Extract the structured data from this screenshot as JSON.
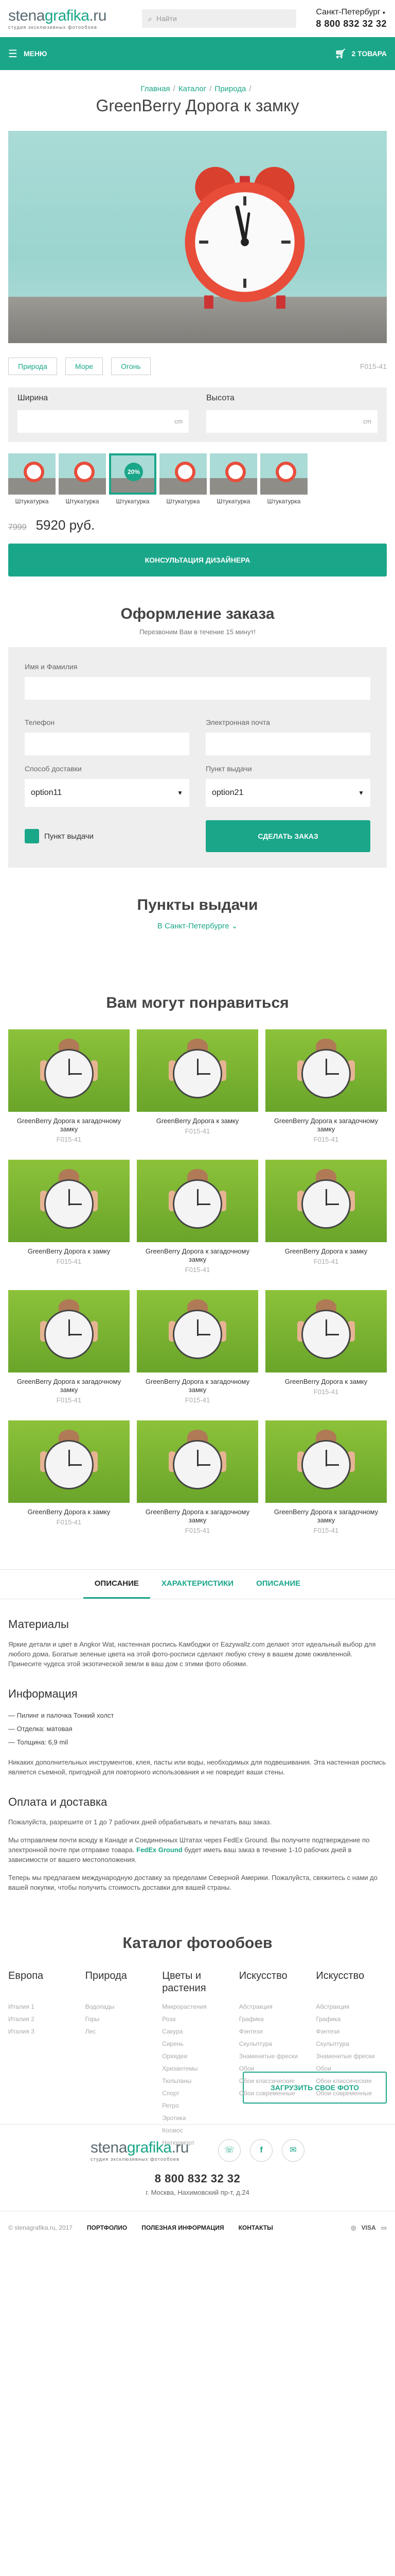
{
  "header": {
    "logo_main_a": "stena",
    "logo_main_b": "grafika",
    "logo_main_c": ".ru",
    "logo_sub": "студия эксклюзивных фотообоев",
    "search_placeholder": "Найти",
    "city": "Санкт-Петербург",
    "phone": "8 800 832 32 32"
  },
  "nav": {
    "menu": "МЕНЮ",
    "cart": "2 ТОВАРА"
  },
  "breadcrumbs": [
    "Главная",
    "Каталог",
    "Природа"
  ],
  "product": {
    "title": "GreenBerry Дорога к замку",
    "tags": [
      "Природа",
      "Море",
      "Огонь"
    ],
    "sku": "F015-41",
    "width_label": "Ширина",
    "height_label": "Высота",
    "unit": "cm",
    "textures": [
      {
        "label": "Штукатурка"
      },
      {
        "label": "Штукатурка"
      },
      {
        "label": "Штукатурка",
        "badge": "20%"
      },
      {
        "label": "Штукатурка"
      },
      {
        "label": "Штукатурка"
      },
      {
        "label": "Штукатурка"
      }
    ],
    "old_price": "7999",
    "price": "5920 руб.",
    "consult_button": "КОНСУЛЬТАЦИЯ ДИЗАЙНЕРА"
  },
  "order": {
    "title": "Оформление заказа",
    "subtitle": "Перезвоним Вам в течение 15 минут!",
    "name_label": "Имя и Фамилия",
    "phone_label": "Телефон",
    "email_label": "Электронная почта",
    "delivery_label": "Способ доставки",
    "delivery_value": "option11",
    "pickup_label": "Пункт выдачи",
    "pickup_value": "option21",
    "checkbox_label": "Пункт выдачи",
    "submit": "СДЕЛАТЬ ЗАКАЗ"
  },
  "pickup": {
    "title": "Пункты выдачи",
    "city": "В Санкт-Петербурге"
  },
  "recommend": {
    "title": "Вам могут понравиться",
    "items": [
      {
        "title": "GreenBerry Дорога к загадочному замку",
        "sku": "F015-41"
      },
      {
        "title": "GreenBerry Дорога к замку",
        "sku": "F015-41"
      },
      {
        "title": "GreenBerry Дорога к загадочному замку",
        "sku": "F015-41"
      },
      {
        "title": "GreenBerry Дорога к замку",
        "sku": "F015-41"
      },
      {
        "title": "GreenBerry Дорога к загадочному замку",
        "sku": "F015-41"
      },
      {
        "title": "GreenBerry Дорога к замку",
        "sku": "F015-41"
      },
      {
        "title": "GreenBerry Дорога к загадочному замку",
        "sku": "F015-41"
      },
      {
        "title": "GreenBerry Дорога к загадочному замку",
        "sku": "F015-41"
      },
      {
        "title": "GreenBerry Дорога к замку",
        "sku": "F015-41"
      },
      {
        "title": "GreenBerry Дорога к замку",
        "sku": "F015-41"
      },
      {
        "title": "GreenBerry Дорога к загадочному замку",
        "sku": "F015-41"
      },
      {
        "title": "GreenBerry Дорога к загадочному замку",
        "sku": "F015-41"
      }
    ]
  },
  "tabs": [
    "ОПИСАНИЕ",
    "ХАРАКТЕРИСТИКИ",
    "ОПИСАНИЕ"
  ],
  "desc": {
    "materials_h": "Материалы",
    "materials_p": "Яркие детали и цвет в Angkor Wat, настенная роспись Камбоджи от Eazywallz.com делают этот идеальный выбор для любого дома. Богатые зеленые цвета на этой фото-росписи сделают любую стену в вашем доме оживленной. Принесите чудеса этой экзотической земли в ваш дом с этими фото обоями.",
    "info_h": "Информация",
    "info_items": [
      "Пилинг и палочка Тонкий холст",
      "Отделка: матовая",
      "Толщина: 6,9 mil"
    ],
    "info_p": "Никаких дополнительных инструментов, клея, пасты или воды, необходимых для подвешивания. Эта настенная роспись является съемной, пригодной для повторного использования и не повредит ваши стены.",
    "pay_h": "Оплата и доставка",
    "pay_p1": "Пожалуйста, разрешите от 1 до 7 рабочих дней обрабатывать и печатать ваш заказ.",
    "pay_p2a": "Мы отправляем почти всюду в Канаде и Соединенных Штатах через FedEx Ground. Вы получите подтверждение по электронной почте при отправке товара.",
    "pay_p2b": "FedEx Ground",
    "pay_p2c": " будет иметь ваш заказ в течение 1-10 рабочих дней в зависимости от вашего местоположения.",
    "pay_p3": "Теперь мы предлагаем международную доставку за пределами Северной Америки. Пожалуйста, свяжитесь с нами до вашей покупки, чтобы получить стоимость доставки для вашей страны."
  },
  "catalog": {
    "title": "Каталог фотообоев",
    "columns": [
      {
        "h": "Европа",
        "items": [
          "Италия 1",
          "Италия 2",
          "Италия 3"
        ]
      },
      {
        "h": "Природа",
        "items": [
          "Водопады",
          "Горы",
          "Лес"
        ]
      },
      {
        "h": "Цветы и растения",
        "items": [
          "Микрорастения",
          "Роза",
          "Сакура",
          "Сирень",
          "Орхидеи",
          "Хризантемы",
          "Тюльпаны",
          "Спорт",
          "Ретро",
          "Эротика",
          "Космос",
          "Натюрморт"
        ]
      },
      {
        "h": "Искусство",
        "items": [
          "Абстракция",
          "Графика",
          "Фэнтези",
          "Скульптура",
          "Знаменитые фрески",
          "Обои",
          "Обои классические",
          "Обои современные"
        ]
      },
      {
        "h": "Искусство",
        "items": [
          "Абстракция",
          "Графика",
          "Фэнтези",
          "Скульптура",
          "Знаменитые фрески",
          "Обои",
          "Обои классические",
          "Обои современные"
        ]
      }
    ],
    "upload_button": "ЗАГРУЗИТЬ СВОЕ ФОТО"
  },
  "footer": {
    "phone": "8 800 832 32 32",
    "address": "г. Москва, Нахимовский пр-т, д.24",
    "social": [
      "☏",
      "f",
      "✉"
    ],
    "copyright": "© stenagrafika.ru, 2017",
    "links": [
      "ПОРТФОЛИО",
      "ПОЛЕЗНАЯ ИНФОРМАЦИЯ",
      "КОНТАКТЫ"
    ],
    "payments": [
      "◎",
      "VISA",
      "▭"
    ]
  },
  "colors": {
    "accent": "#1aa689",
    "clock": "#e84d3a"
  }
}
